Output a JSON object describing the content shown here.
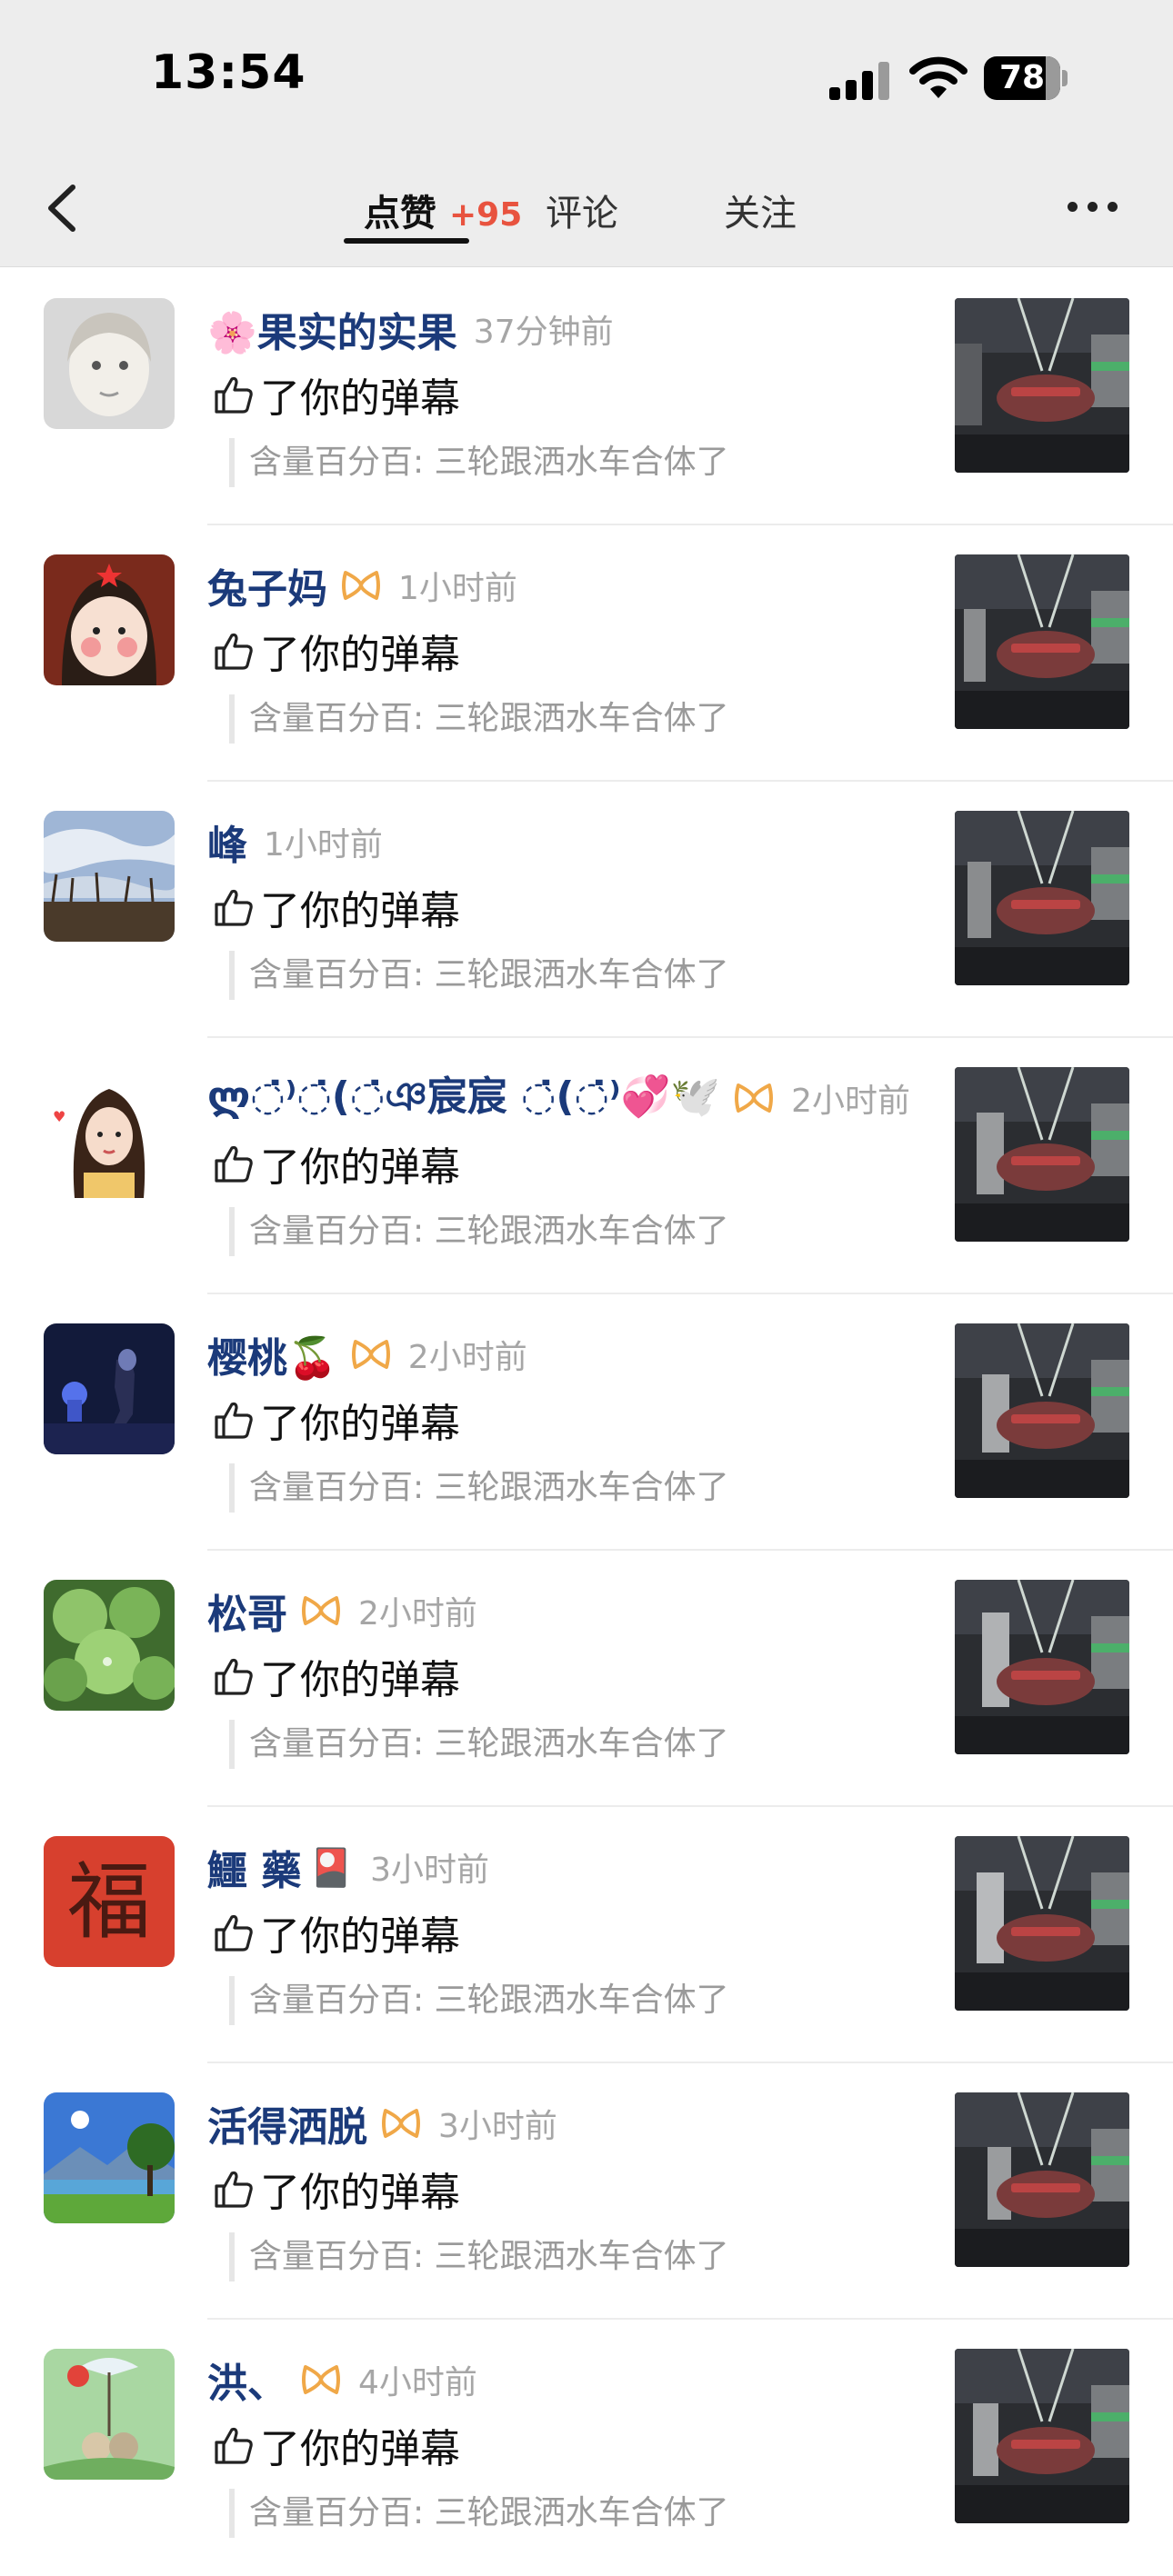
{
  "status_bar": {
    "time": "13:54",
    "battery": "78"
  },
  "header": {
    "back_icon": "chevron-left-icon",
    "tabs": [
      {
        "label": "点赞",
        "count": "+95",
        "active": true
      },
      {
        "label": "评论",
        "active": false
      },
      {
        "label": "关注",
        "active": false
      }
    ],
    "more_icon": "ellipsis-icon"
  },
  "notification": {
    "like_text": "了你的弹幕",
    "quote_text": "含量百分百: 三轮跟洒水车合体了"
  },
  "items": [
    {
      "name": "🌸果实的实果",
      "vip": false,
      "badge": "",
      "time": "37分钟前"
    },
    {
      "name": "兔子妈",
      "vip": true,
      "badge": "",
      "time": "1小时前"
    },
    {
      "name": "峰",
      "vip": false,
      "badge": "",
      "time": "1小时前"
    },
    {
      "name": "ლ◌̇⁾◌̇(◌̇ঞ宸宸  ◌̇(◌̇⁾💞🕊️",
      "vip": true,
      "badge": "",
      "time": "2小时前"
    },
    {
      "name": "樱桃🍒",
      "vip": true,
      "badge": "",
      "time": "2小时前"
    },
    {
      "name": "松哥",
      "vip": true,
      "badge": "",
      "time": "2小时前"
    },
    {
      "name": "鱷 藥",
      "vip": false,
      "badge": "🎴",
      "time": "3小时前"
    },
    {
      "name": "活得洒脱",
      "vip": true,
      "badge": "",
      "time": "3小时前"
    },
    {
      "name": "洪、",
      "vip": true,
      "badge": "",
      "time": "4小时前"
    }
  ],
  "colors": {
    "accent_count": "#e8533f",
    "name": "#1b3a7a",
    "muted": "#a6a6a6",
    "header_bg": "#ededed"
  }
}
